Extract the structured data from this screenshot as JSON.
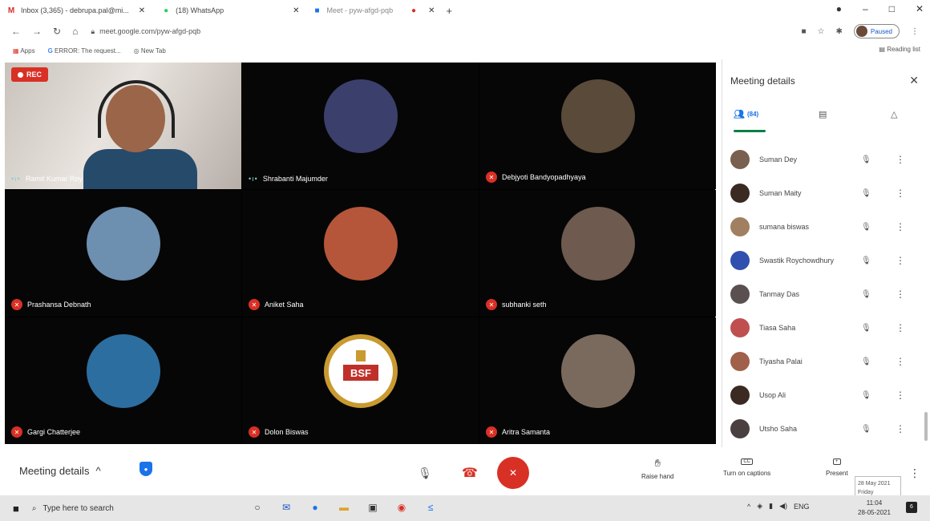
{
  "browser": {
    "tabs": [
      {
        "label": "Inbox (3,365) - debrupa.pal@mi...",
        "icon": "gmail-icon",
        "color": "#d93025"
      },
      {
        "label": "(18) WhatsApp",
        "icon": "whatsapp-icon",
        "color": "#25d366"
      },
      {
        "label": "Meet - pyw-afgd-pqb",
        "icon": "meet-icon",
        "color": "#1a73e8"
      }
    ],
    "url": "meet.google.com/pyw-afgd-pqb",
    "profile_label": "Paused",
    "bookmarks": [
      "Apps",
      "ERROR: The request...",
      "New Tab"
    ],
    "reading_list": "Reading list"
  },
  "rec_label": "REC",
  "tiles": [
    {
      "name": "Ramit Kumar Roy",
      "mic": "on",
      "avatar_color": "#9b6549"
    },
    {
      "name": "Shrabanti Majumder",
      "mic": "on",
      "avatar_color": "#3b3f6b"
    },
    {
      "name": "Debjyoti Bandyopadhyaya",
      "mic": "off",
      "avatar_color": "#5a4a3a"
    },
    {
      "name": "Prashansa Debnath",
      "mic": "off",
      "avatar_color": "#6d8fb0"
    },
    {
      "name": "Aniket Saha",
      "mic": "off",
      "avatar_color": "#b5563a"
    },
    {
      "name": "subhanki seth",
      "mic": "off",
      "avatar_color": "#6e5a4f"
    },
    {
      "name": "Gargi Chatterjee",
      "mic": "off",
      "avatar_color": "#2d6ea0"
    },
    {
      "name": "Dolon Biswas",
      "mic": "off",
      "avatar_color": "#c0a060"
    },
    {
      "name": "Aritra Samanta",
      "mic": "off",
      "avatar_color": "#7a6a5e"
    }
  ],
  "panel": {
    "title": "Meeting details",
    "people_count": "(84)",
    "participants": [
      {
        "name": "Suman Dey",
        "avatar_color": "#7a6050"
      },
      {
        "name": "Suman Maity",
        "avatar_color": "#3a2a22"
      },
      {
        "name": "sumana biswas",
        "avatar_color": "#a08060"
      },
      {
        "name": "Swastik Roychowdhury",
        "avatar_color": "#3050b0"
      },
      {
        "name": "Tanmay Das",
        "avatar_color": "#5a5050"
      },
      {
        "name": "Tiasa Saha",
        "avatar_color": "#c05050"
      },
      {
        "name": "Tiyasha Palai",
        "avatar_color": "#a0604a"
      },
      {
        "name": "Usop Ali",
        "avatar_color": "#3a2a22"
      },
      {
        "name": "Utsho Saha",
        "avatar_color": "#4a4040"
      }
    ]
  },
  "bottom": {
    "meeting_details": "Meeting details",
    "raise_hand": "Raise hand",
    "captions": "Turn on captions",
    "present": "Present"
  },
  "tooltip": {
    "line1": "28 May 2021",
    "line2": "Friday"
  },
  "taskbar": {
    "search_placeholder": "Type here to search",
    "lang": "ENG",
    "time": "11:04",
    "date": "28-05-2021",
    "notif_count": "6"
  }
}
